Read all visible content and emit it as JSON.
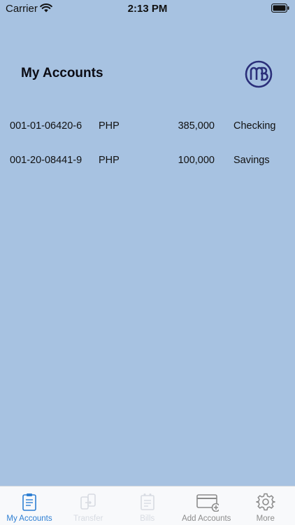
{
  "status_bar": {
    "carrier": "Carrier",
    "time": "2:13 PM"
  },
  "header": {
    "title": "My Accounts",
    "logo_icon": "mb-bank-logo-icon"
  },
  "accounts": [
    {
      "number": "001-01-06420-6",
      "currency": "PHP",
      "balance": "385,000",
      "type": "Checking"
    },
    {
      "number": "001-20-08441-9",
      "currency": "PHP",
      "balance": "100,000",
      "type": "Savings"
    }
  ],
  "tab_bar": {
    "tabs": [
      {
        "label": "My Accounts",
        "icon": "accounts-clipboard-icon",
        "state": "active"
      },
      {
        "label": "Transfer",
        "icon": "transfer-phone-icon",
        "state": "disabled"
      },
      {
        "label": "Bills",
        "icon": "bills-icon",
        "state": "disabled"
      },
      {
        "label": "Add Accounts",
        "icon": "add-card-icon",
        "state": "enabled"
      },
      {
        "label": "More",
        "icon": "gear-icon",
        "state": "enabled"
      }
    ]
  },
  "colors": {
    "background": "#a7c2e1",
    "accent": "#2e7fd3",
    "logo": "#2b2f7a",
    "tab_bar": "#f8f9fb"
  }
}
